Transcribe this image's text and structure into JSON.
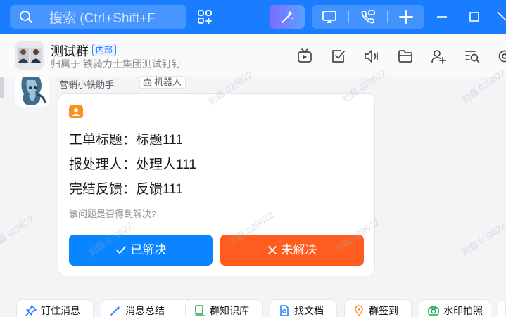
{
  "topbar": {
    "search_placeholder": "搜索 (Ctrl+Shift+F",
    "icons": [
      "search-icon",
      "add-app-icon",
      "ai-magic-icon",
      "screen-cast-icon",
      "call-icon",
      "add-icon",
      "minimize-icon",
      "maximize-icon"
    ]
  },
  "header": {
    "group_name": "测试群",
    "badge": "内部",
    "subtitle": "归属于 铁骑力士集团测试钉钉",
    "icons": [
      "live-icon",
      "todo-icon",
      "voice-icon",
      "folder-icon",
      "add-member-icon",
      "search-chat-icon",
      "settings-icon"
    ]
  },
  "message": {
    "sender": "营销小铁助手",
    "robot_tag": "机器人",
    "card": {
      "rows": [
        "工单标题：标题111",
        "报处理人：处理人111",
        "完结反馈：反馈111"
      ],
      "question": "该问题是否得到解决?",
      "btn_resolved": "已解决",
      "btn_unresolved": "未解决"
    }
  },
  "toolbar": {
    "chips": [
      "钉住消息",
      "消息总结",
      "群知识库",
      "找文档",
      "群签到",
      "水印拍照"
    ]
  },
  "watermark": "刘磊 029622",
  "colors": {
    "brand": "#1a7cff",
    "resolved": "#0b84ff",
    "unresolved": "#ff5c1f",
    "card_icon": "#ff8f1f"
  }
}
